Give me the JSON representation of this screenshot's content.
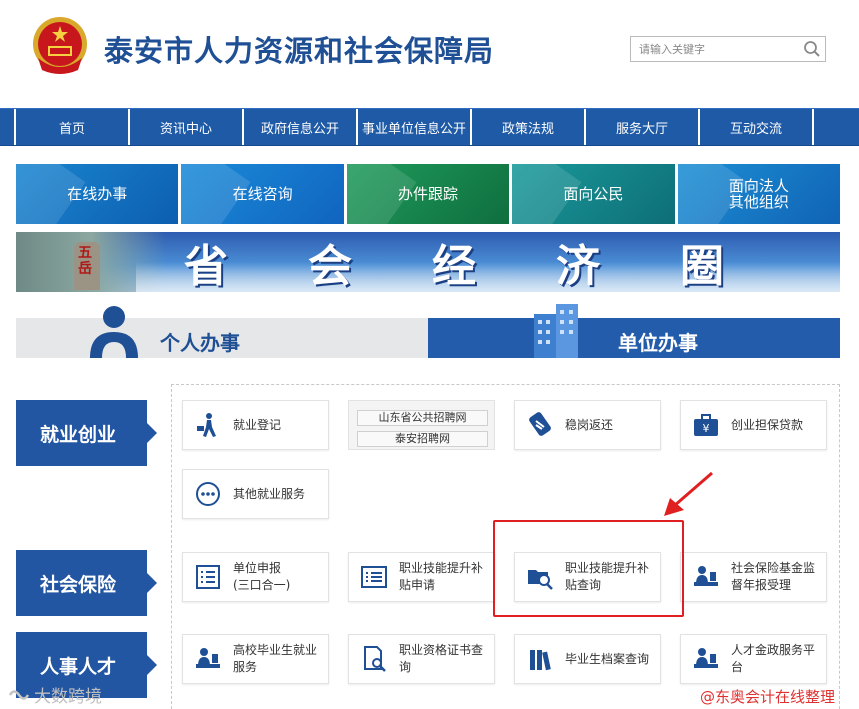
{
  "header": {
    "site_title": "泰安市人力资源和社会保障局",
    "search_placeholder": "请输入关键字"
  },
  "nav": {
    "items": [
      "首页",
      "资讯中心",
      "政府信息公开",
      "事业单位信息公开",
      "政策法规",
      "服务大厅",
      "互动交流"
    ]
  },
  "quick_tiles": [
    "在线办事",
    "在线咨询",
    "办件跟踪",
    "面向公民",
    "面向法人\n其他组织"
  ],
  "banner": {
    "rock_text": "五岳",
    "slogan": [
      "省",
      "会",
      "经",
      "济",
      "圈"
    ]
  },
  "tabs": {
    "personal": "个人办事",
    "unit": "单位办事"
  },
  "categories": {
    "employment": "就业创业",
    "insurance": "社会保险",
    "hr": "人事人才"
  },
  "services": {
    "employment_register": "就业登记",
    "recruit_links": [
      "山东省公共招聘网",
      "泰安招聘网"
    ],
    "job_stabilize_refund": "稳岗返还",
    "startup_loan": "创业担保贷款",
    "other_employment": "其他就业服务",
    "unit_declare": "单位申报\n(三口合一)",
    "skill_subsidy_apply": "职业技能提升补\n贴申请",
    "skill_subsidy_query": "职业技能提升补\n贴查询",
    "insurance_fund_annual": "社会保险基金监\n督年报受理",
    "graduate_employment": "高校毕业生就业\n服务",
    "qualification_query": "职业资格证书查\n询",
    "graduate_archive_query": "毕业生档案查询",
    "talent_service": "人才金政服务平\n台"
  },
  "watermarks": {
    "left": "大数跨境",
    "right": "@东奥会计在线整理"
  },
  "colors": {
    "brand_blue": "#1f5aa6",
    "category_blue": "#2255a2",
    "highlight_red": "#e02020"
  }
}
